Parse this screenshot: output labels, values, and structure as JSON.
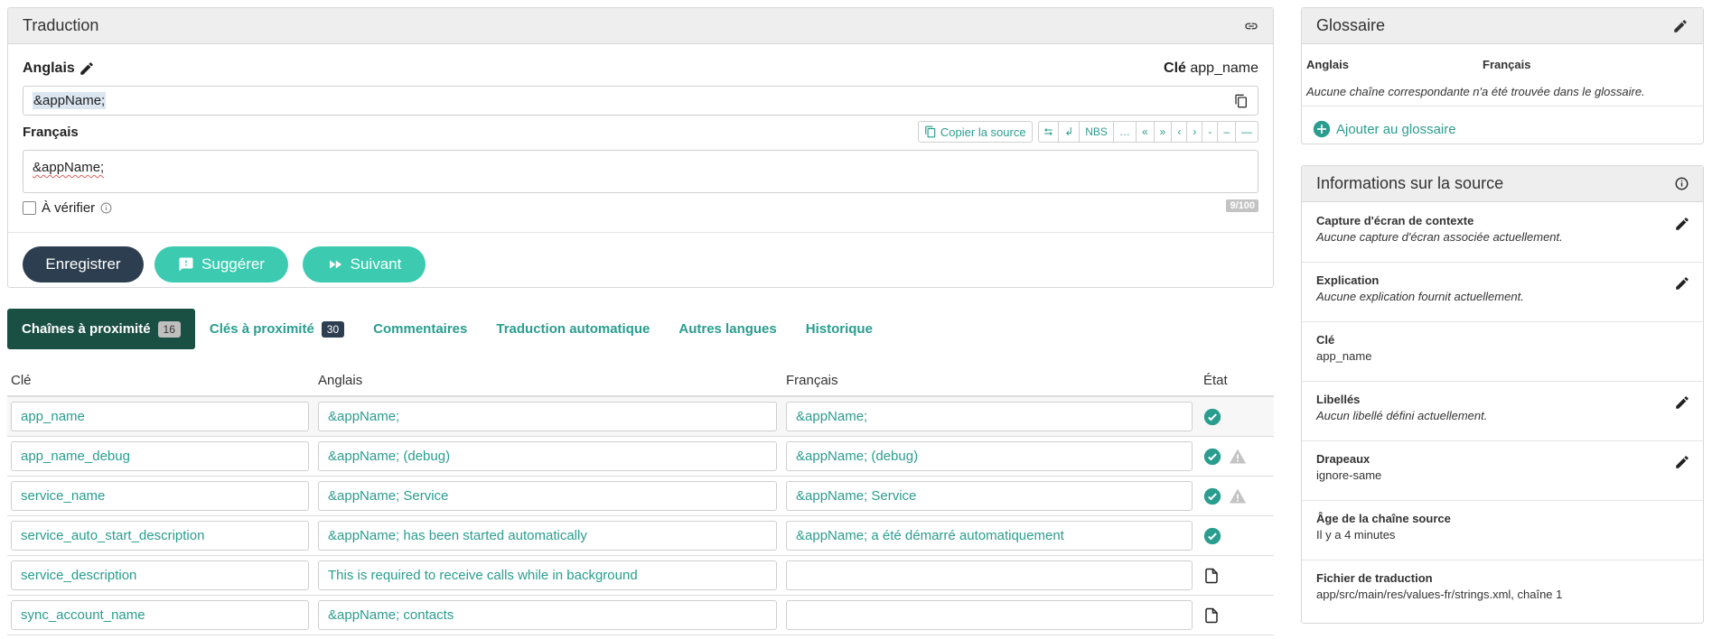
{
  "translation": {
    "title": "Traduction",
    "source_lang": "Anglais",
    "key_label": "Clé",
    "key_value": "app_name",
    "source_text": "&appName;",
    "target_lang": "Français",
    "copy_source": "Copier la source",
    "toolbar_chars": [
      "⮀",
      "↲",
      "NBS",
      "…",
      "«",
      "»",
      "‹",
      "›",
      "-",
      "–",
      "—"
    ],
    "target_text": "&appName;",
    "verify_label": "À vérifier",
    "counter": "9/100",
    "save_label": "Enregistrer",
    "suggest_label": "Suggérer",
    "next_label": "Suivant"
  },
  "tabs": [
    {
      "label": "Chaînes à proximité",
      "badge": "16"
    },
    {
      "label": "Clés à proximité",
      "badge": "30"
    },
    {
      "label": "Commentaires"
    },
    {
      "label": "Traduction automatique"
    },
    {
      "label": "Autres langues"
    },
    {
      "label": "Historique"
    }
  ],
  "table": {
    "headers": [
      "Clé",
      "Anglais",
      "Français",
      "État"
    ],
    "rows": [
      {
        "key": "app_name",
        "en": "&appName;",
        "fr": "&appName;",
        "state": [
          "check-icon"
        ]
      },
      {
        "key": "app_name_debug",
        "en": "&appName; (debug)",
        "fr": "&appName; (debug)",
        "state": [
          "check-icon",
          "warning-icon"
        ]
      },
      {
        "key": "service_name",
        "en": "&appName; Service",
        "fr": "&appName; Service",
        "state": [
          "check-icon",
          "warning-icon"
        ]
      },
      {
        "key": "service_auto_start_description",
        "en": "&appName; has been started automatically",
        "fr": "&appName; a été démarré automatiquement",
        "state": [
          "check-icon"
        ]
      },
      {
        "key": "service_description",
        "en": "This is required to receive calls while in background",
        "fr": "",
        "state": [
          "file-icon"
        ]
      },
      {
        "key": "sync_account_name",
        "en": "&appName; contacts",
        "fr": "",
        "state": [
          "file-icon"
        ]
      }
    ]
  },
  "glossary": {
    "title": "Glossaire",
    "col_en": "Anglais",
    "col_fr": "Français",
    "empty_msg": "Aucune chaîne correspondante n'a été trouvée dans le glossaire.",
    "add_label": "Ajouter au glossaire"
  },
  "source_info": {
    "title": "Informations sur la source",
    "items": [
      {
        "title": "Capture d'écran de contexte",
        "value": "Aucune capture d'écran associée actuellement.",
        "italic": true,
        "editable": true
      },
      {
        "title": "Explication",
        "value": "Aucune explication fournit actuellement.",
        "italic": true,
        "editable": true
      },
      {
        "title": "Clé",
        "value": "app_name",
        "italic": false,
        "editable": false
      },
      {
        "title": "Libellés",
        "value": "Aucun libellé défini actuellement.",
        "italic": true,
        "editable": true
      },
      {
        "title": "Drapeaux",
        "value": "ignore-same",
        "italic": false,
        "editable": true
      },
      {
        "title": "Âge de la chaîne source",
        "value": "Il y a 4 minutes",
        "italic": false,
        "editable": false
      },
      {
        "title": "Fichier de traduction",
        "value": "app/src/main/res/values-fr/strings.xml, chaîne 1",
        "italic": false,
        "editable": false
      }
    ]
  },
  "colors": {
    "accent": "#2a9d8f",
    "dark": "#2c3e50",
    "teal_button": "#3ccbb0",
    "active_tab": "#1a5044"
  }
}
